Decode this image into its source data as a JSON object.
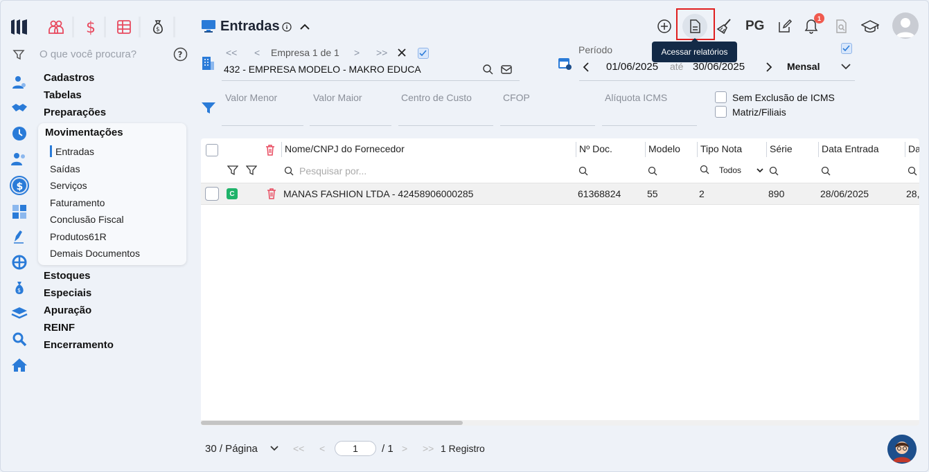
{
  "colors": {
    "accent": "#2a7bd8",
    "highlight_box": "#e01e1e",
    "tooltip_bg": "#132a47",
    "badge": "#f05a4f",
    "tag_green": "#1fb36a"
  },
  "sidebar": {
    "search_placeholder": "O que você procura?",
    "menu": [
      "Cadastros",
      "Tabelas",
      "Preparações"
    ],
    "group": {
      "title": "Movimentações",
      "items": [
        "Entradas",
        "Saídas",
        "Serviços",
        "Faturamento",
        "Conclusão Fiscal",
        "Produtos61R",
        "Demais Documentos"
      ]
    },
    "menu_after": [
      "Estoques",
      "Especiais",
      "Apuração",
      "REINF",
      "Encerramento"
    ]
  },
  "header": {
    "title": "Entradas",
    "pg_label": "PG",
    "notification_count": "1",
    "tooltip": "Acessar relatórios"
  },
  "company": {
    "pager": "Empresa 1 de 1",
    "name": "432 - EMPRESA MODELO - MAKRO EDUCA"
  },
  "period": {
    "label": "Período",
    "start": "01/06/2025",
    "sep": "até",
    "end": "30/06/2025",
    "mode": "Mensal"
  },
  "filters": {
    "fields": [
      "Valor Menor",
      "Valor Maior",
      "Centro de Custo",
      "CFOP",
      "Alíquota ICMS"
    ],
    "checkboxes": [
      "Sem Exclusão de ICMS",
      "Matriz/Filiais"
    ]
  },
  "table": {
    "columns": [
      "Nome/CNPJ do Fornecedor",
      "Nº Doc.",
      "Modelo",
      "Tipo Nota",
      "Série",
      "Data Entrada",
      "Da"
    ],
    "search_placeholder": "Pesquisar por...",
    "tipo_filter": "Todos",
    "rows": [
      {
        "tag": "C",
        "fornecedor": "MANAS FASHION LTDA - 42458906000285",
        "doc": "61368824",
        "modelo": "55",
        "tipo": "2",
        "serie": "890",
        "data": "28/06/2025",
        "extra": "28,"
      }
    ]
  },
  "footer": {
    "per_page": "30 / Página",
    "page": "1",
    "total_pages": "/ 1",
    "records": "1 Registro"
  }
}
